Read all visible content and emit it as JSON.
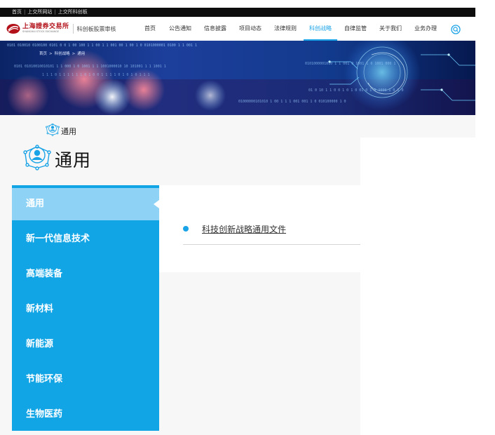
{
  "topbar": {
    "links": [
      "首页",
      "上交所网站",
      "上交所科创板"
    ],
    "separator": "|"
  },
  "header": {
    "logo_cn": "上海證券交易所",
    "logo_en": "SHANGHAI STOCK EXCHANGE",
    "logo_sub": "科创板股票审核",
    "brand_color": "#b3121b",
    "accent_color": "#1aa3e6",
    "nav": [
      {
        "label": "首页",
        "active": false
      },
      {
        "label": "公告通知",
        "active": false
      },
      {
        "label": "信息披露",
        "active": false
      },
      {
        "label": "项目动态",
        "active": false
      },
      {
        "label": "法律规则",
        "active": false
      },
      {
        "label": "科创战略",
        "active": true
      },
      {
        "label": "自律监管",
        "active": false
      },
      {
        "label": "关于我们",
        "active": false
      },
      {
        "label": "业务办理",
        "active": false
      }
    ],
    "search_icon": "search-icon"
  },
  "banner": {
    "breadcrumb": [
      "首页",
      "科创战略",
      "通用"
    ],
    "binary_strings": [
      "0101 010010 0100100 0101 0 0 1 00 100 1 1 00 1 1 001 00 1 00 1 0 0101000001 0100 1 1 001 1",
      "0101 01010010010101 1 1 000 1 0 1001 1 1 1001000010 10 101001 1 1 1001 1",
      "1 1 1 0 1 1 1 1 1 1 0 1 0 0 1 1 1 1 0 1 0 1 0 1 1 1",
      "0101000001010 1 1 001 0 1001 1 0 1001 000 1",
      "01 0 10 1 1 0 0 1 0 1 0 01 0 1 0 1000 1 0 1 0",
      "01000000101010 1 00 1 1 1 001 001 1 0 010100000 1 0"
    ]
  },
  "section": {
    "title": "通用",
    "crumb_label": "通用",
    "icon": "network-person-icon"
  },
  "sidebar": {
    "items": [
      {
        "label": "通用",
        "active": true
      },
      {
        "label": "新一代信息技术",
        "active": false
      },
      {
        "label": "高端装备",
        "active": false
      },
      {
        "label": "新材料",
        "active": false
      },
      {
        "label": "新能源",
        "active": false
      },
      {
        "label": "节能环保",
        "active": false
      },
      {
        "label": "生物医药",
        "active": false
      }
    ]
  },
  "documents": [
    {
      "title": "科技创新战略通用文件"
    }
  ]
}
